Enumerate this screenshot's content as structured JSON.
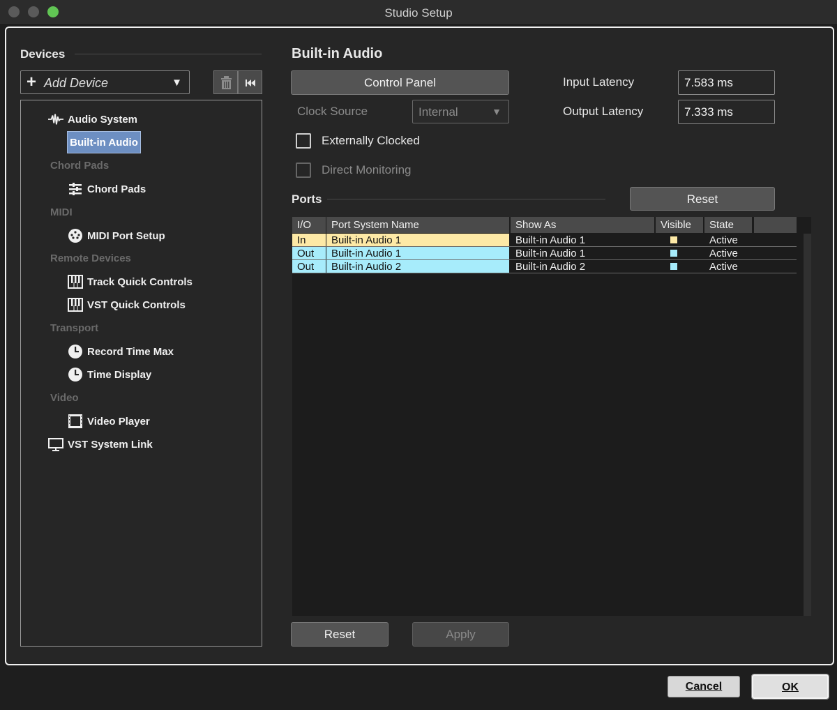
{
  "window": {
    "title": "Studio Setup"
  },
  "devices": {
    "title": "Devices",
    "add_device_label": "Add Device",
    "tree": {
      "audio_system": "Audio System",
      "built_in_audio": "Built-in Audio",
      "cat_chord_pads": "Chord Pads",
      "chord_pads": "Chord Pads",
      "cat_midi": "MIDI",
      "midi_port_setup": "MIDI Port Setup",
      "cat_remote_devices": "Remote Devices",
      "track_quick_controls": "Track Quick Controls",
      "vst_quick_controls": "VST Quick Controls",
      "cat_transport": "Transport",
      "record_time_max": "Record Time Max",
      "time_display": "Time Display",
      "cat_video": "Video",
      "video_player": "Video Player",
      "vst_system_link": "VST System Link"
    }
  },
  "panel": {
    "title": "Built-in Audio",
    "control_panel_label": "Control Panel",
    "clock_source_label": "Clock Source",
    "clock_source_value": "Internal",
    "input_latency_label": "Input Latency",
    "input_latency_value": "7.583 ms",
    "output_latency_label": "Output Latency",
    "output_latency_value": "7.333 ms",
    "externally_clocked_label": "Externally Clocked",
    "direct_monitoring_label": "Direct Monitoring",
    "ports_title": "Ports",
    "ports_reset_label": "Reset",
    "reset_label": "Reset",
    "apply_label": "Apply"
  },
  "ports_table": {
    "columns": [
      "I/O",
      "Port System Name",
      "Show As",
      "Visible",
      "State"
    ],
    "rows": [
      {
        "io": "In",
        "system_name": "Built-in Audio 1",
        "show_as": "Built-in Audio 1",
        "visible_color": "#fde9a6",
        "state": "Active",
        "row_color": "#fde9a6"
      },
      {
        "io": "Out",
        "system_name": "Built-in Audio 1",
        "show_as": "Built-in Audio 1",
        "visible_color": "#a7ecfb",
        "state": "Active",
        "row_color": "#a7ecfb"
      },
      {
        "io": "Out",
        "system_name": "Built-in Audio 2",
        "show_as": "Built-in Audio 2",
        "visible_color": "#a7ecfb",
        "state": "Active",
        "row_color": "#a7ecfb"
      }
    ]
  },
  "footer": {
    "cancel_label": "Cancel",
    "ok_label": "OK"
  },
  "colors": {
    "selection": "#6d8fc2",
    "input_port": "#fde9a6",
    "output_port": "#a7ecfb",
    "maximize": "#61c554"
  }
}
